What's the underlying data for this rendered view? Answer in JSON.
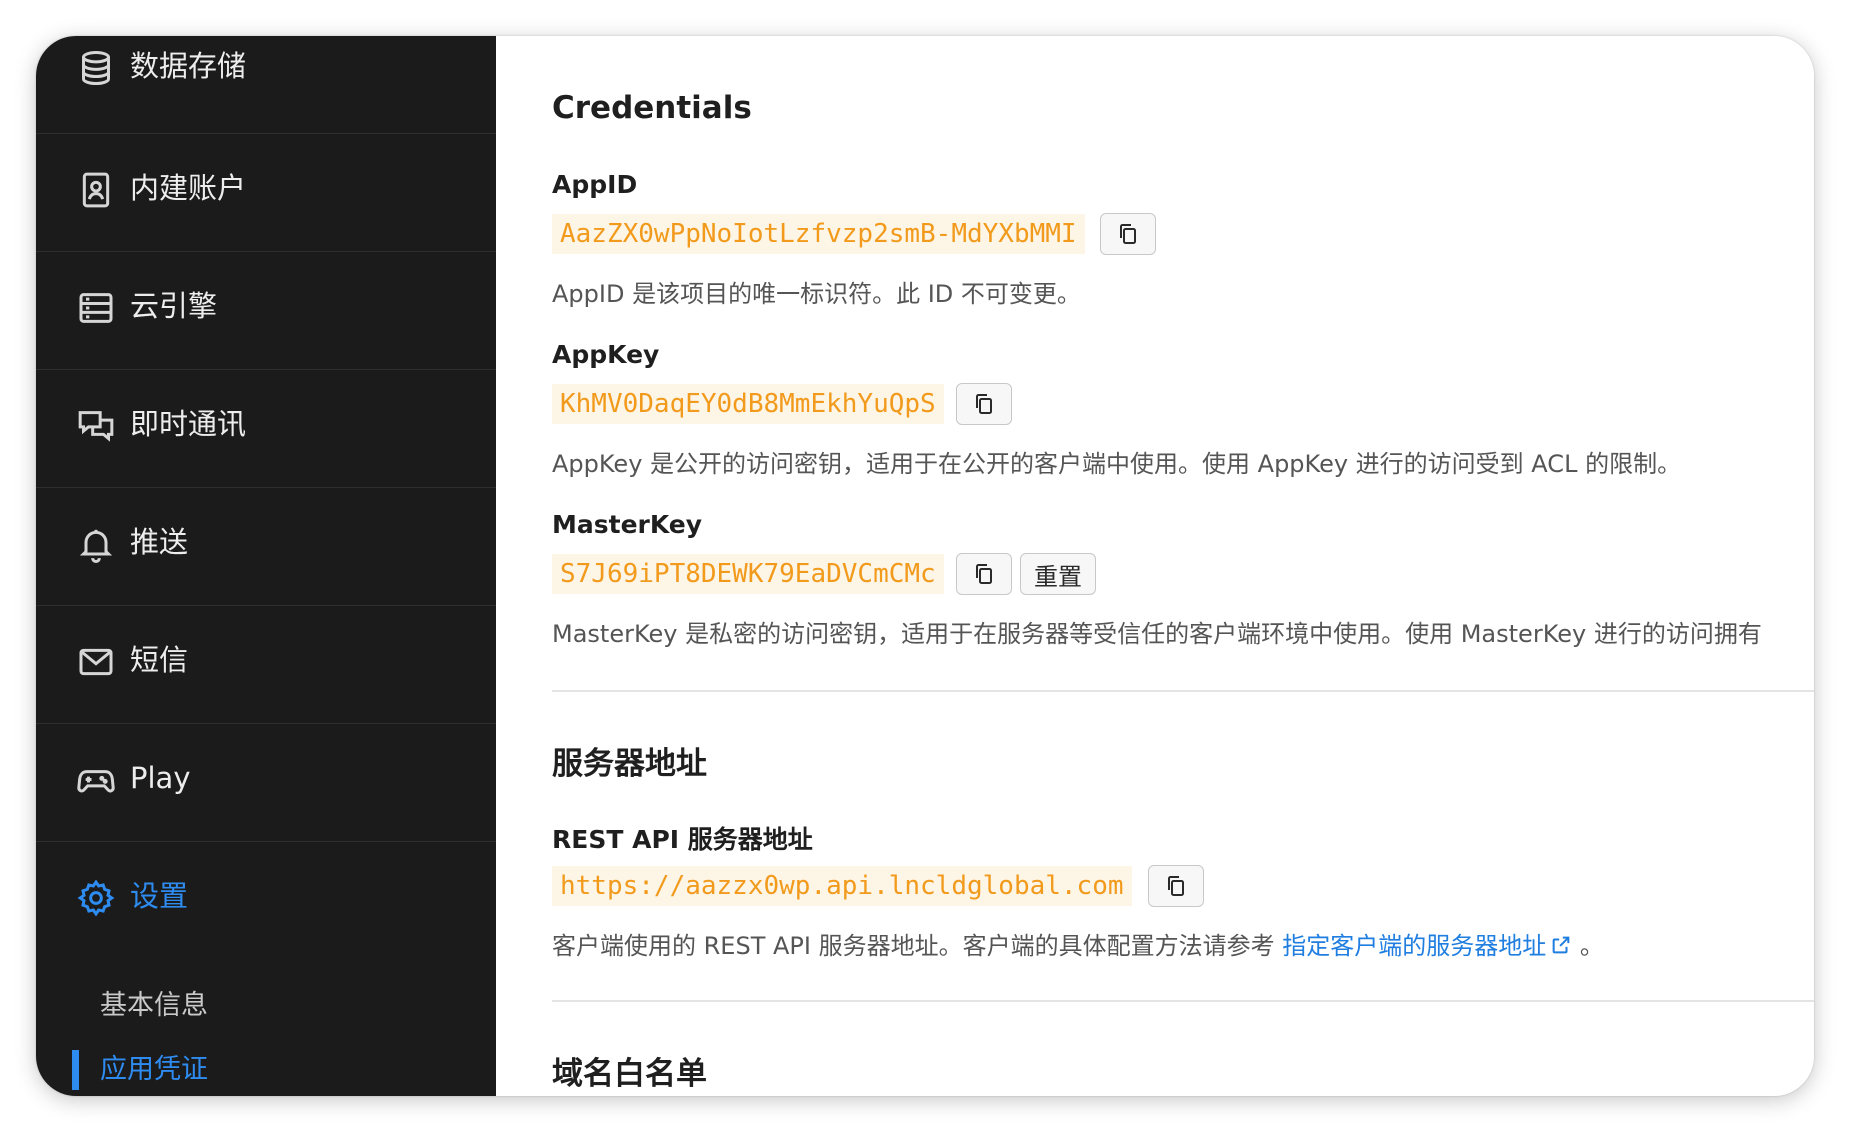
{
  "sidebar": {
    "items": [
      {
        "label": "数据存储",
        "icon": "database-icon"
      },
      {
        "label": "内建账户",
        "icon": "user-card-icon"
      },
      {
        "label": "云引擎",
        "icon": "server-icon"
      },
      {
        "label": "即时通讯",
        "icon": "chat-bubbles-icon"
      },
      {
        "label": "推送",
        "icon": "bell-icon"
      },
      {
        "label": "短信",
        "icon": "mail-icon"
      },
      {
        "label": "Play",
        "icon": "gamepad-icon"
      },
      {
        "label": "设置",
        "icon": "gear-icon",
        "active": true
      }
    ],
    "sub_items": [
      {
        "label": "基本信息"
      },
      {
        "label": "应用凭证",
        "active": true
      }
    ]
  },
  "credentials": {
    "heading": "Credentials",
    "app_id": {
      "label": "AppID",
      "value": "AazZX0wPpNoIotLzfvzp2smB-MdYXbMMI",
      "desc": "AppID 是该项目的唯一标识符。此 ID 不可变更。"
    },
    "app_key": {
      "label": "AppKey",
      "value": "KhMV0DaqEY0dB8MmEkhYuQpS",
      "desc": "AppKey 是公开的访问密钥，适用于在公开的客户端中使用。使用 AppKey 进行的访问受到 ACL 的限制。"
    },
    "master_key": {
      "label": "MasterKey",
      "value": "S7J69iPT8DEWK79EaDVCmCMc",
      "reset_label": "重置",
      "desc": "MasterKey 是私密的访问密钥，适用于在服务器等受信任的客户端环境中使用。使用 MasterKey 进行的访问拥有"
    }
  },
  "server": {
    "heading": "服务器地址",
    "rest_api": {
      "label": "REST API 服务器地址",
      "value": "https://aazzx0wp.api.lncldglobal.com",
      "desc_prefix": "客户端使用的 REST API 服务器地址。客户端的具体配置方法请参考",
      "link_text": "指定客户端的服务器地址",
      "desc_suffix": "。"
    }
  },
  "domain_whitelist": {
    "heading": "域名白名单"
  },
  "colors": {
    "sidebar_bg": "#1b1b1b",
    "accent": "#2e8bf0",
    "code_text": "#f29a1c",
    "code_bg": "#fdf5e6",
    "link": "#1f7ee0"
  }
}
